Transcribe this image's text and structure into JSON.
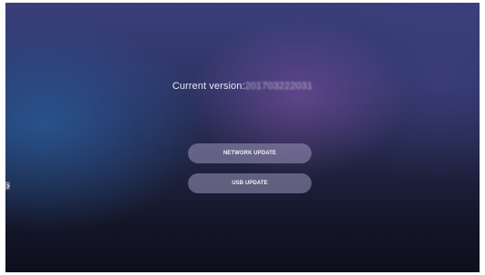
{
  "version": {
    "label": "Current version:",
    "value": "201703222031"
  },
  "buttons": {
    "network_update": "NETWORK UPDATE",
    "usb_update": "USB UPDATE"
  },
  "icons": {
    "side_tab": "chevron-right-icon"
  },
  "colors": {
    "button_fill": "#9b96b9",
    "text": "#e9e9f2"
  }
}
